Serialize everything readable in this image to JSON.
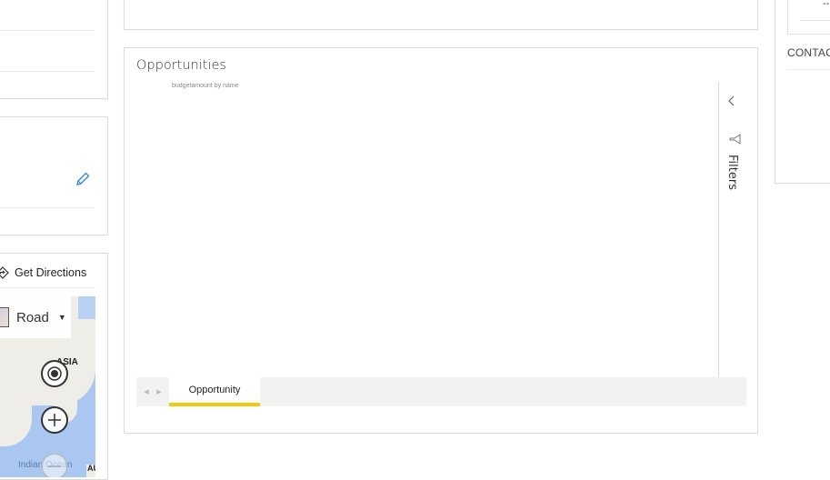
{
  "left_panel": {
    "get_directions_label": "Get Directions",
    "map": {
      "layer_selector_value": "Road",
      "labels": {
        "asia": "ASIA",
        "ocean": "Indian Ocean",
        "australia": "AU"
      }
    }
  },
  "opportunities": {
    "title": "Opportunities",
    "visual_subtitle": "budgetamount by name",
    "filters_label": "Filters",
    "page_tabs": [
      {
        "label": "Opportunity",
        "active": true
      }
    ],
    "accent_color": "#f2c811"
  },
  "right_panel": {
    "section_label": "CONTACTS",
    "value_placeholder": "--"
  }
}
